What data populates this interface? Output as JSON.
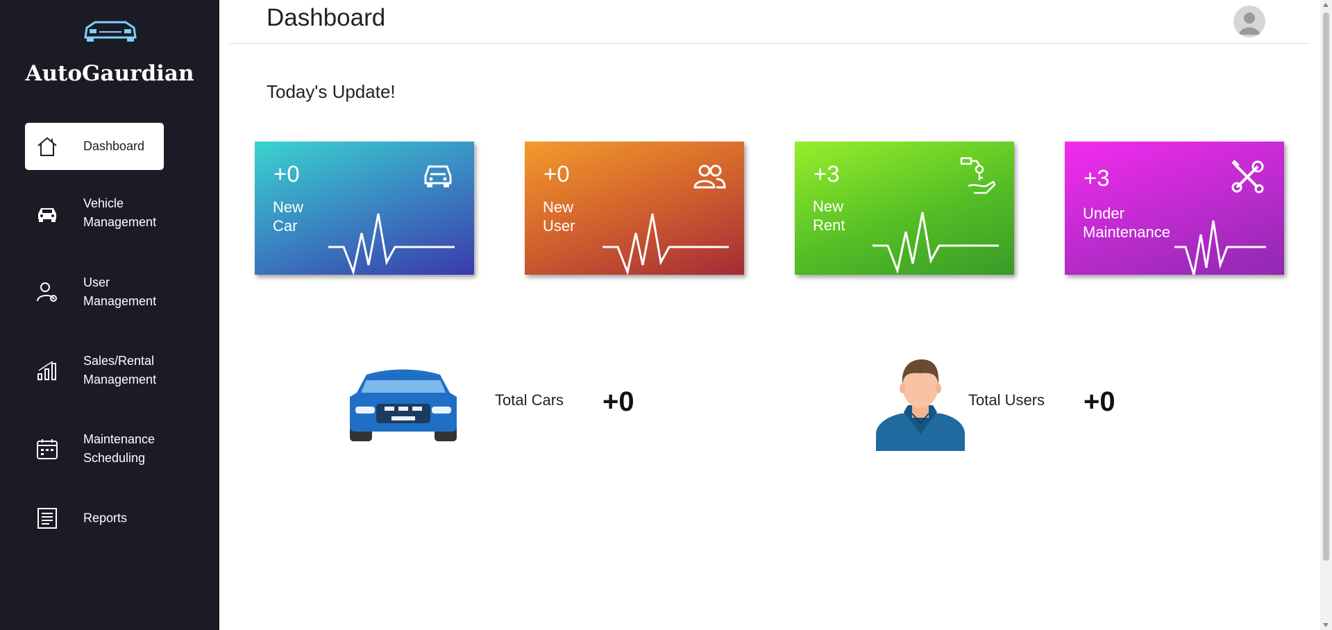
{
  "brand": {
    "name": "AutoGaurdian",
    "icon": "car-front-icon"
  },
  "header": {
    "title": "Dashboard",
    "avatar_icon": "user-avatar-icon"
  },
  "sidebar": {
    "items": [
      {
        "label": "Dashboard",
        "icon": "home-icon",
        "active": true
      },
      {
        "label": "Vehicle\nManagement",
        "icon": "car-icon"
      },
      {
        "label": "User\nManagement",
        "icon": "user-gear-icon"
      },
      {
        "label": "Sales/Rental\nManagement",
        "icon": "bar-chart-icon"
      },
      {
        "label": "Maintenance\nScheduling",
        "icon": "calendar-icon"
      },
      {
        "label": "Reports",
        "icon": "report-icon"
      }
    ]
  },
  "main": {
    "subtitle": "Today's Update!",
    "cards": [
      {
        "count": "+0",
        "label": "New\nCar",
        "icon": "car-icon"
      },
      {
        "count": "+0",
        "label": "New\nUser",
        "icon": "users-icon"
      },
      {
        "count": "+3",
        "label": "New\nRent",
        "icon": "key-hand-icon"
      },
      {
        "count": "+3",
        "label": "Under\nMaintenance",
        "icon": "tools-icon"
      }
    ],
    "totals": [
      {
        "label": "Total Cars",
        "value": "+0",
        "icon": "blue-car-illustration"
      },
      {
        "label": "Total Users",
        "value": "+0",
        "icon": "man-avatar-illustration"
      }
    ]
  },
  "colors": {
    "sidebar_bg": "#1b1b25",
    "card_car": "#3a86c2",
    "card_user": "#d2622d",
    "card_rent": "#55bf25",
    "card_maintenance": "#c02bd0"
  }
}
